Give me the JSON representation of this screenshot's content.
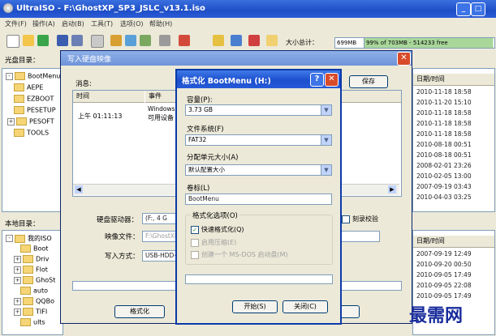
{
  "main_window": {
    "title": "UltraISO - F:\\GhostXP_SP3_JSLC_v13.1.iso",
    "menu": [
      "文件(F)",
      "操作(A)",
      "启动(B)",
      "工具(T)",
      "选项(O)",
      "帮助(H)"
    ],
    "size_label": "大小总计：",
    "size_value": "699MB",
    "size_detail": "99% of 703MB - 514233 free",
    "cd_dir_label": "光盘目录：",
    "local_dir_label": "本地目录：",
    "date_header": "日期/时间",
    "tree_top": [
      "BootMenu",
      "AEPE",
      "EZBOOT",
      "PESETUP",
      "PESOFT",
      "TOOLS"
    ],
    "tree_bottom": [
      "我的ISO",
      "Boot",
      "Driv",
      "Flot",
      "GhoSt",
      "auto",
      "QQBo",
      "TIFI",
      "ults"
    ],
    "dates_top": [
      "2010-11-18 18:58",
      "2010-11-20 15:10",
      "2010-11-18 18:58",
      "2010-11-18 18:58",
      "2010-11-18 18:58",
      "2010-08-18 00:51",
      "2010-08-18 00:51",
      "2008-02-01 23:26",
      "2010-02-05 13:00",
      "2007-09-19 03:43",
      "2010-04-03 03:25"
    ],
    "dates_bottom": [
      "2007-09-19 12:49",
      "2010-09-20 00:50",
      "2010-09-05 17:49",
      "2010-09-05 22:08",
      "2010-09-05 17:49"
    ]
  },
  "write_dialog": {
    "title": "写入硬盘映像",
    "save_label": "保存",
    "message_label": "消息:",
    "col_time": "时间",
    "col_event": "事件",
    "log_time": "上午 01:11:13",
    "log_event_1": "Windows",
    "log_event_2": "可用设备",
    "drive_label": "硬盘驱动器：",
    "drive_value": "(F:, 4 G",
    "verify_label": "刻录校验",
    "image_label": "映像文件：",
    "image_value": "F:\\GhostXP",
    "method_label": "写入方式：",
    "method_value": "USB-HDD+",
    "format_btn": "格式化"
  },
  "format_dialog": {
    "title": "格式化 BootMenu (H:)",
    "help": "?",
    "capacity_label": "容量(P):",
    "capacity_value": "3.73 GB",
    "fs_label": "文件系统(F)",
    "fs_value": "FAT32",
    "unit_label": "分配单元大小(A)",
    "unit_value": "默认配置大小",
    "volume_label": "卷标(L)",
    "volume_value": "BootMenu",
    "options_label": "格式化选项(O)",
    "opt_quick": "快速格式化(Q)",
    "opt_compress": "启用压缩(E)",
    "opt_msdos": "创建一个 MS-DOS 启动盘(M)",
    "start_btn": "开始(S)",
    "close_btn": "关闭(C)"
  },
  "watermark": "最需网",
  "colors": {
    "title_blue": "#1f4fc6",
    "dialog_bg": "#ece9d8",
    "close_red": "#d84b2a",
    "watermark": "#1a2d9c"
  }
}
